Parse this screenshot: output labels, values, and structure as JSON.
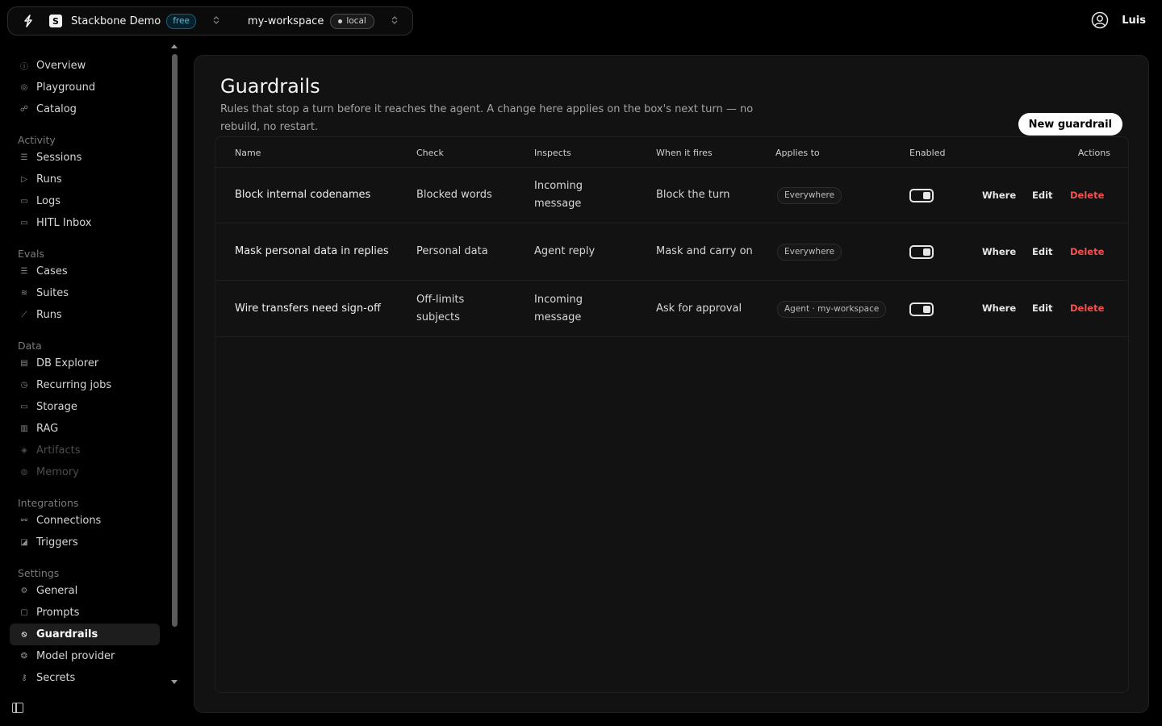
{
  "topbar": {
    "org_name": "Stackbone Demo",
    "org_logo_letter": "S",
    "org_plan": "free",
    "workspace_name": "my-workspace",
    "workspace_env": "local",
    "user_name": "Luis"
  },
  "sidebar": {
    "top": [
      {
        "label": "Overview",
        "icon": "info-circle-icon"
      },
      {
        "label": "Playground",
        "icon": "playground-icon"
      },
      {
        "label": "Catalog",
        "icon": "users-icon"
      }
    ],
    "sections": [
      {
        "title": "Activity",
        "items": [
          {
            "label": "Sessions",
            "icon": "list-icon"
          },
          {
            "label": "Runs",
            "icon": "play-icon"
          },
          {
            "label": "Logs",
            "icon": "log-icon"
          },
          {
            "label": "HITL Inbox",
            "icon": "inbox-icon"
          }
        ]
      },
      {
        "title": "Evals",
        "items": [
          {
            "label": "Cases",
            "icon": "checklist-icon"
          },
          {
            "label": "Suites",
            "icon": "layers-icon"
          },
          {
            "label": "Runs",
            "icon": "chart-icon"
          }
        ]
      },
      {
        "title": "Data",
        "items": [
          {
            "label": "DB Explorer",
            "icon": "database-icon"
          },
          {
            "label": "Recurring jobs",
            "icon": "clock-icon"
          },
          {
            "label": "Storage",
            "icon": "storage-icon"
          },
          {
            "label": "RAG",
            "icon": "books-icon"
          },
          {
            "label": "Artifacts",
            "icon": "artifact-icon",
            "disabled": true
          },
          {
            "label": "Memory",
            "icon": "memory-icon",
            "disabled": true
          }
        ]
      },
      {
        "title": "Integrations",
        "items": [
          {
            "label": "Connections",
            "icon": "plug-icon"
          },
          {
            "label": "Triggers",
            "icon": "trigger-icon"
          }
        ]
      },
      {
        "title": "Settings",
        "items": [
          {
            "label": "General",
            "icon": "gear-icon"
          },
          {
            "label": "Prompts",
            "icon": "prompt-icon"
          },
          {
            "label": "Guardrails",
            "icon": "shield-off-icon",
            "active": true
          },
          {
            "label": "Model provider",
            "icon": "model-icon"
          },
          {
            "label": "Secrets",
            "icon": "key-icon"
          }
        ]
      }
    ]
  },
  "page": {
    "title": "Guardrails",
    "description": "Rules that stop a turn before it reaches the agent. A change here applies on the box's next turn — no rebuild, no restart.",
    "new_button": "New guardrail"
  },
  "table": {
    "headers": {
      "name": "Name",
      "check": "Check",
      "inspects": "Inspects",
      "fires": "When it fires",
      "applies": "Applies to",
      "enabled": "Enabled",
      "actions": "Actions"
    },
    "rows": [
      {
        "name": "Block internal codenames",
        "check": "Blocked words",
        "inspects": "Incoming message",
        "fires": "Block the turn",
        "applies": "Everywhere",
        "enabled": true
      },
      {
        "name": "Mask personal data in replies",
        "check": "Personal data",
        "inspects": "Agent reply",
        "fires": "Mask and carry on",
        "applies": "Everywhere",
        "enabled": true
      },
      {
        "name": "Wire transfers need sign-off",
        "check": "Off-limits subjects",
        "inspects": "Incoming message",
        "fires": "Ask for approval",
        "applies": "Agent · my-workspace",
        "enabled": true
      }
    ],
    "actions": {
      "where": "Where",
      "edit": "Edit",
      "delete": "Delete"
    }
  }
}
